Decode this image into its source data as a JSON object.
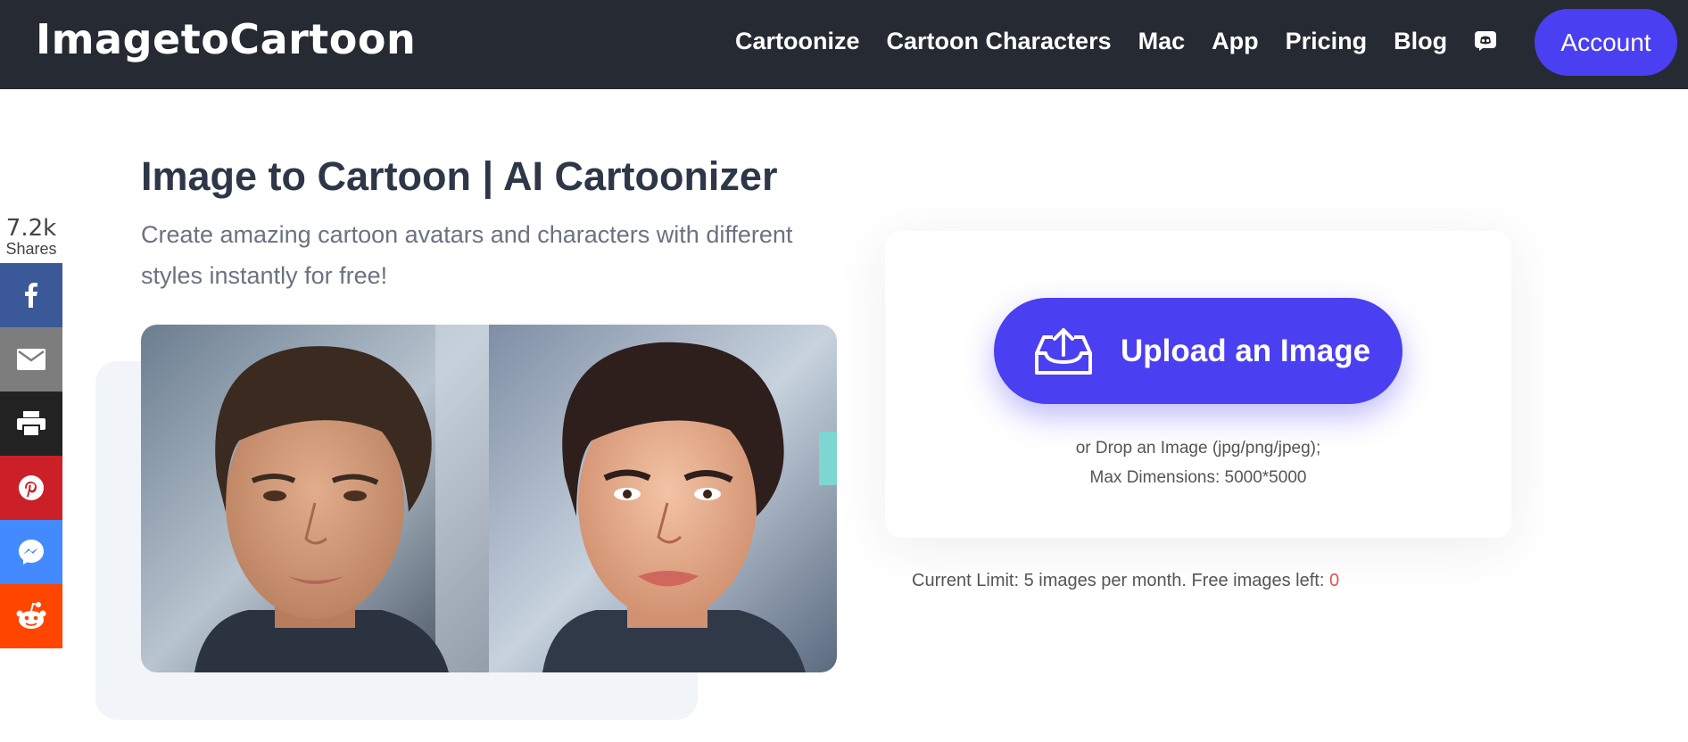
{
  "header": {
    "logo": "ImagetoCartoon",
    "nav": [
      "Cartoonize",
      "Cartoon Characters",
      "Mac",
      "App",
      "Pricing",
      "Blog"
    ],
    "discord_icon": "discord-icon",
    "account_label": "Account",
    "bg_color": "#252a33",
    "accent_color": "#4b3ff2"
  },
  "share": {
    "count": "7.2k",
    "label": "Shares",
    "buttons": [
      {
        "name": "facebook",
        "icon": "facebook-icon",
        "color": "#3b5998"
      },
      {
        "name": "email",
        "icon": "email-icon",
        "color": "#7d7d7d"
      },
      {
        "name": "print",
        "icon": "print-icon",
        "color": "#222222"
      },
      {
        "name": "pinterest",
        "icon": "pinterest-icon",
        "color": "#cb2027"
      },
      {
        "name": "messenger",
        "icon": "messenger-icon",
        "color": "#448aff"
      },
      {
        "name": "reddit",
        "icon": "reddit-icon",
        "color": "#ff4500"
      }
    ]
  },
  "hero": {
    "title": "Image to Cartoon | AI Cartoonizer",
    "subtitle": "Create amazing cartoon avatars and characters with different styles instantly for free!",
    "image": "before/after photo of a young man: realistic photo on the left, cartoonized painting on the right"
  },
  "upload": {
    "button_label": "Upload an Image",
    "icon": "upload-inbox-icon",
    "drop_line1": "or Drop an Image (jpg/png/jpeg);",
    "drop_line2": "Max Dimensions: 5000*5000",
    "limit_text": "Current Limit: 5 images per month. Free images left: ",
    "free_left": "0"
  }
}
